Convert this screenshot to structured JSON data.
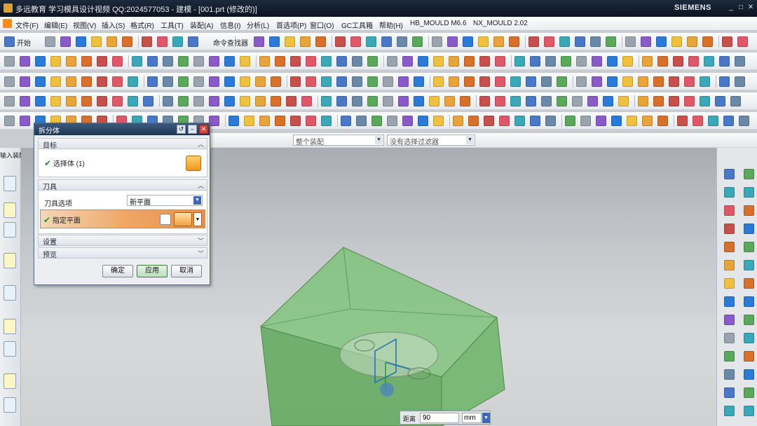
{
  "titlebar": {
    "title": "多远教育 学习模具设计视频 QQ:2024577053 - 建模 - [001.prt (修改的)]",
    "brand": "SIEMENS",
    "min": "_",
    "max": "□",
    "close": "✕"
  },
  "menubar": {
    "items": [
      "文件(F)",
      "编辑(E)",
      "视图(V)",
      "插入(S)",
      "格式(R)",
      "工具(T)",
      "装配(A)",
      "信息(I)",
      "分析(L)",
      "首选项(P)",
      "窗口(O)",
      "GC工具箱",
      "帮助(H)",
      "HB_MOULD M6.6",
      "NX_MOULD 2.02"
    ]
  },
  "toolbar": {
    "start_label": "开始",
    "command_finder_label": "命令查找器"
  },
  "selection_bar": {
    "filter_value": "整个装配",
    "type_value": "没有选择过滤器"
  },
  "left_strip": {
    "tab_label": "输入装配导"
  },
  "dialog": {
    "title": "拆分体",
    "sections": {
      "target": {
        "header": "目标",
        "item": "选择体 (1)"
      },
      "tool": {
        "header": "刀具",
        "tool_option_label": "刀具选项",
        "tool_option_value": "新平面",
        "plane_item": "指定平面"
      },
      "settings": {
        "header": "设置"
      },
      "preview": {
        "header": "预览"
      }
    },
    "buttons": {
      "ok": "确定",
      "apply": "应用",
      "cancel": "取消"
    }
  },
  "dim_entry": {
    "label": "距离",
    "value": "90",
    "unit": "mm"
  },
  "colors": {
    "block_green": "#6fb86a",
    "accent_orange": "#f0a868",
    "title_blue": "#1e3656"
  }
}
